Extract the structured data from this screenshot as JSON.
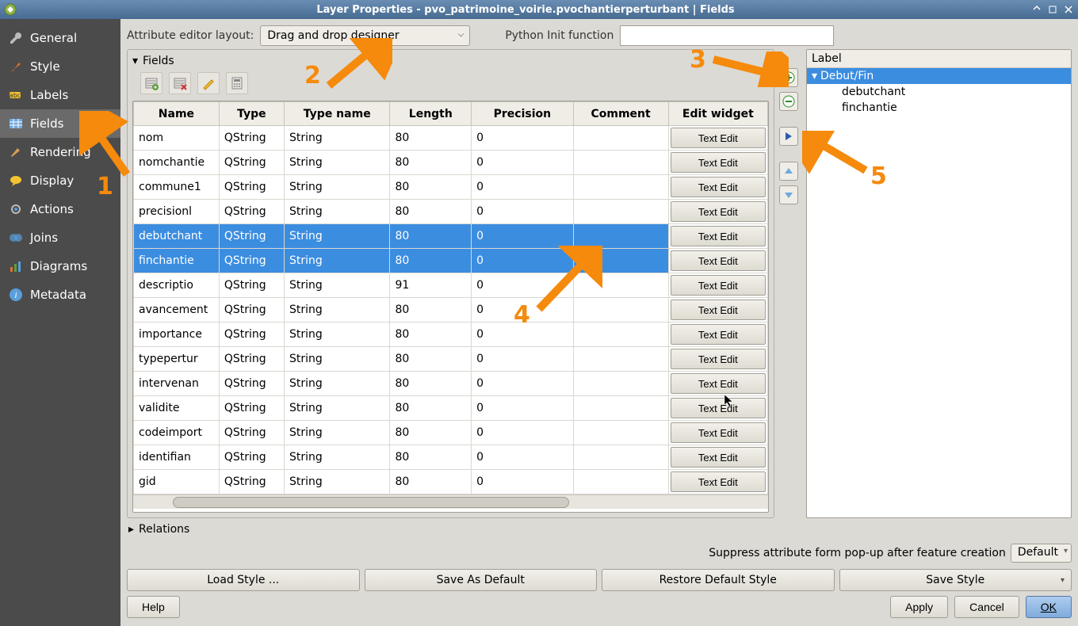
{
  "window": {
    "title": "Layer Properties - pvo_patrimoine_voirie.pvochantierperturbant | Fields"
  },
  "sidebar": {
    "items": [
      {
        "label": "General",
        "icon": "wrench"
      },
      {
        "label": "Style",
        "icon": "brush"
      },
      {
        "label": "Labels",
        "icon": "tag"
      },
      {
        "label": "Fields",
        "icon": "grid",
        "active": true
      },
      {
        "label": "Rendering",
        "icon": "paint"
      },
      {
        "label": "Display",
        "icon": "bubble"
      },
      {
        "label": "Actions",
        "icon": "gear"
      },
      {
        "label": "Joins",
        "icon": "join"
      },
      {
        "label": "Diagrams",
        "icon": "chart"
      },
      {
        "label": "Metadata",
        "icon": "info"
      }
    ]
  },
  "top": {
    "attr_editor_label": "Attribute editor layout:",
    "attr_editor_value": "Drag and drop designer",
    "python_label": "Python Init function",
    "python_value": ""
  },
  "fields_section": {
    "title": "Fields",
    "columns": [
      "Name",
      "Type",
      "Type name",
      "Length",
      "Precision",
      "Comment",
      "Edit widget"
    ],
    "rows": [
      {
        "name": "nom",
        "type": "QString",
        "typename": "String",
        "length": "80",
        "precision": "0",
        "comment": "",
        "widget": "Text Edit"
      },
      {
        "name": "nomchantie",
        "type": "QString",
        "typename": "String",
        "length": "80",
        "precision": "0",
        "comment": "",
        "widget": "Text Edit"
      },
      {
        "name": "commune1",
        "type": "QString",
        "typename": "String",
        "length": "80",
        "precision": "0",
        "comment": "",
        "widget": "Text Edit"
      },
      {
        "name": "precisionl",
        "type": "QString",
        "typename": "String",
        "length": "80",
        "precision": "0",
        "comment": "",
        "widget": "Text Edit"
      },
      {
        "name": "debutchant",
        "type": "QString",
        "typename": "String",
        "length": "80",
        "precision": "0",
        "comment": "",
        "widget": "Text Edit",
        "selected": true
      },
      {
        "name": "finchantie",
        "type": "QString",
        "typename": "String",
        "length": "80",
        "precision": "0",
        "comment": "",
        "widget": "Text Edit",
        "selected": true
      },
      {
        "name": "descriptio",
        "type": "QString",
        "typename": "String",
        "length": "91",
        "precision": "0",
        "comment": "",
        "widget": "Text Edit"
      },
      {
        "name": "avancement",
        "type": "QString",
        "typename": "String",
        "length": "80",
        "precision": "0",
        "comment": "",
        "widget": "Text Edit"
      },
      {
        "name": "importance",
        "type": "QString",
        "typename": "String",
        "length": "80",
        "precision": "0",
        "comment": "",
        "widget": "Text Edit"
      },
      {
        "name": "typepertur",
        "type": "QString",
        "typename": "String",
        "length": "80",
        "precision": "0",
        "comment": "",
        "widget": "Text Edit"
      },
      {
        "name": "intervenan",
        "type": "QString",
        "typename": "String",
        "length": "80",
        "precision": "0",
        "comment": "",
        "widget": "Text Edit"
      },
      {
        "name": "validite",
        "type": "QString",
        "typename": "String",
        "length": "80",
        "precision": "0",
        "comment": "",
        "widget": "Text Edit"
      },
      {
        "name": "codeimport",
        "type": "QString",
        "typename": "String",
        "length": "80",
        "precision": "0",
        "comment": "",
        "widget": "Text Edit"
      },
      {
        "name": "identifian",
        "type": "QString",
        "typename": "String",
        "length": "80",
        "precision": "0",
        "comment": "",
        "widget": "Text Edit"
      },
      {
        "name": "gid",
        "type": "QString",
        "typename": "String",
        "length": "80",
        "precision": "0",
        "comment": "",
        "widget": "Text Edit"
      }
    ]
  },
  "right_panel": {
    "header": "Label",
    "group": "Debut/Fin",
    "children": [
      "debutchant",
      "finchantie"
    ]
  },
  "relations_label": "Relations",
  "suppress": {
    "label": "Suppress attribute form pop-up after feature creation",
    "value": "Default"
  },
  "buttons": {
    "load_style": "Load Style ...",
    "save_default": "Save As Default",
    "restore_default": "Restore Default Style",
    "save_style": "Save Style",
    "help": "Help",
    "apply": "Apply",
    "cancel": "Cancel",
    "ok": "OK"
  },
  "annotations": {
    "n1": "1",
    "n2": "2",
    "n3": "3",
    "n4": "4",
    "n5": "5"
  }
}
